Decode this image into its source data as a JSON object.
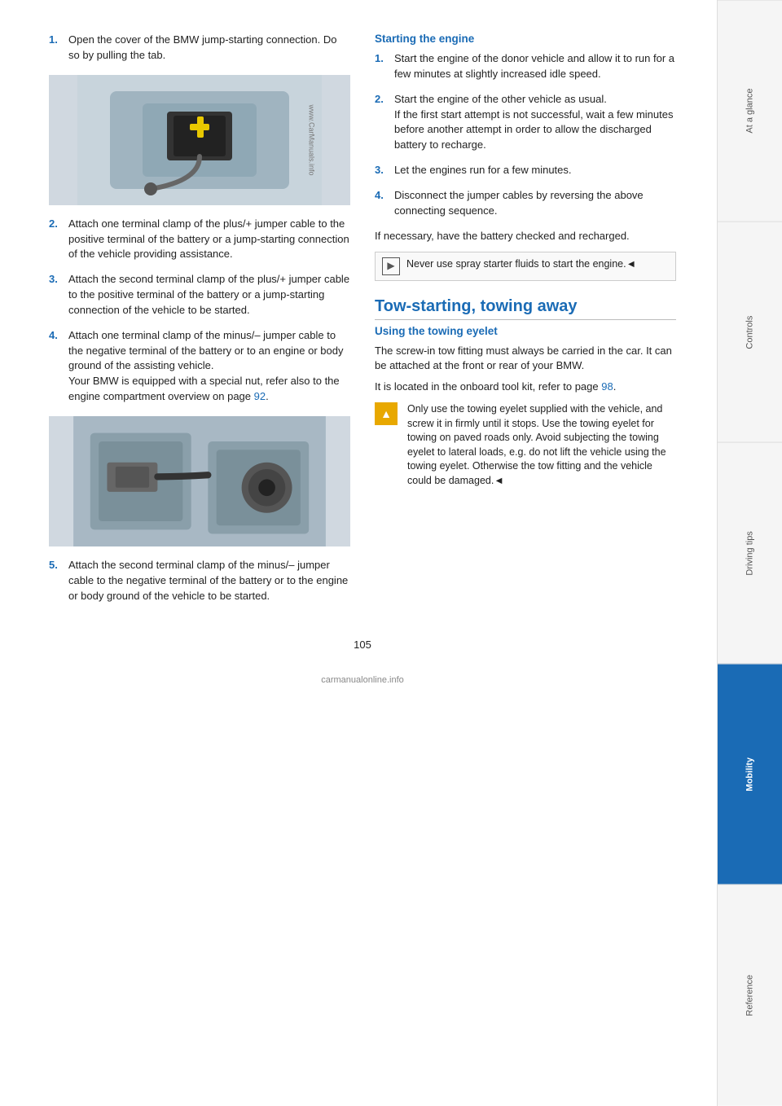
{
  "sidebar": {
    "tabs": [
      {
        "label": "At a glance",
        "active": false
      },
      {
        "label": "Controls",
        "active": false
      },
      {
        "label": "Driving tips",
        "active": false
      },
      {
        "label": "Mobility",
        "active": true
      },
      {
        "label": "Reference",
        "active": false
      }
    ]
  },
  "page_number": "105",
  "left_column": {
    "steps": [
      {
        "number": "1.",
        "text": "Open the cover of the BMW jump-starting connection. Do so by pulling the tab."
      },
      {
        "number": "2.",
        "text": "Attach one terminal clamp of the plus/+ jumper cable to the positive terminal of the battery or a jump-starting connection of the vehicle providing assistance."
      },
      {
        "number": "3.",
        "text": "Attach the second terminal clamp of the plus/+ jumper cable to the positive terminal of the battery or a jump-starting connection of the vehicle to be started."
      },
      {
        "number": "4.",
        "text": "Attach one terminal clamp of the minus/– jumper cable to the negative terminal of the battery or to an engine or body ground of the assisting vehicle.\nYour BMW is equipped with a special nut, refer also to the engine compartment overview on page 92."
      },
      {
        "number": "5.",
        "text": "Attach the second terminal clamp of the minus/– jumper cable to the negative terminal of the battery or to the engine or body ground of the vehicle to be started."
      }
    ],
    "page_ref_92": "92",
    "image1_alt": "BMW jump-starting connection cover",
    "image2_alt": "Jumper cable clamp attachment"
  },
  "right_column": {
    "starting_engine_heading": "Starting the engine",
    "starting_steps": [
      {
        "number": "1.",
        "text": "Start the engine of the donor vehicle and allow it to run for a few minutes at slightly increased idle speed."
      },
      {
        "number": "2.",
        "text": "Start the engine of the other vehicle as usual.\nIf the first start attempt is not successful, wait a few minutes before another attempt in order to allow the discharged battery to recharge."
      },
      {
        "number": "3.",
        "text": "Let the engines run for a few minutes."
      },
      {
        "number": "4.",
        "text": "Disconnect the jumper cables by reversing the above connecting sequence."
      }
    ],
    "note_text": "If necessary, have the battery checked and recharged.",
    "caution_text": "Never use spray starter fluids to start the engine.◄",
    "tow_section_title": "Tow-starting, towing away",
    "tow_eyelet_heading": "Using the towing eyelet",
    "tow_eyelet_para1": "The screw-in tow fitting must always be carried in the car. It can be attached at the front or rear of your BMW.",
    "tow_eyelet_para2": "It is located in the onboard tool kit, refer to page 98.",
    "tow_page_ref": "98",
    "warning_text": "Only use the towing eyelet supplied with the vehicle, and screw it in firmly until it stops. Use the towing eyelet for towing on paved roads only. Avoid subjecting the towing eyelet to lateral loads, e.g. do not lift the vehicle using the towing eyelet. Otherwise the tow fitting and the vehicle could be damaged.◄"
  },
  "bottom_logo": "carmanualonline.info"
}
